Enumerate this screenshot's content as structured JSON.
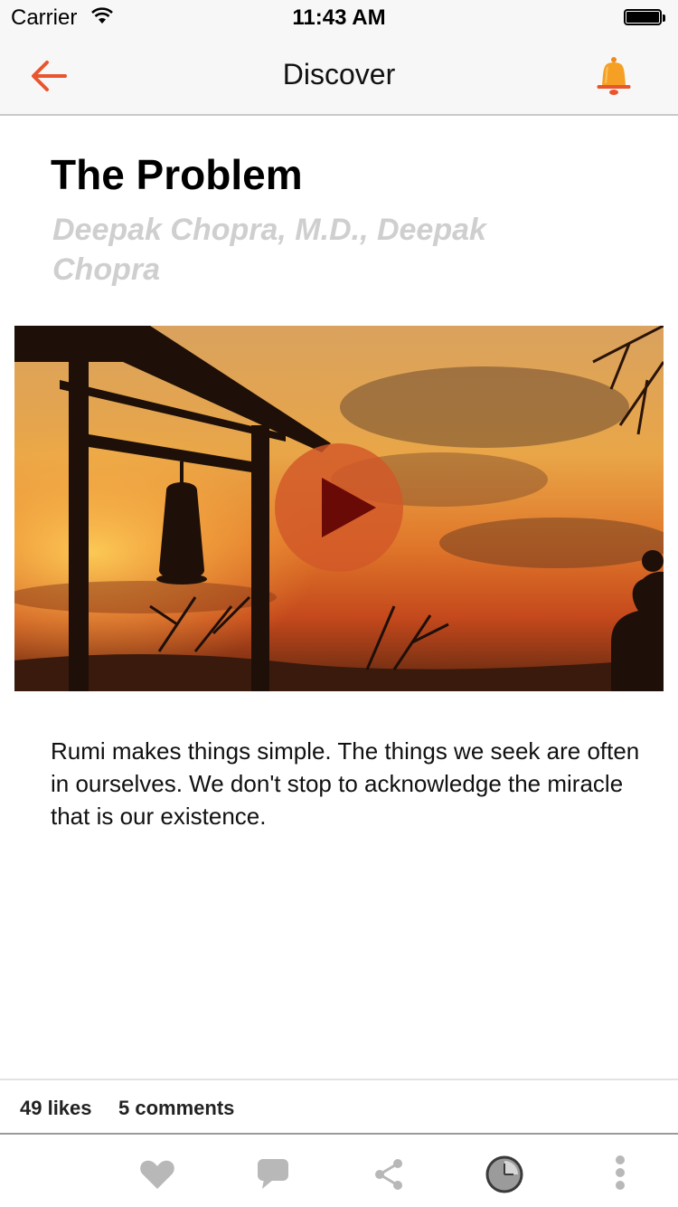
{
  "status_bar": {
    "carrier": "Carrier",
    "time": "11:43 AM"
  },
  "nav": {
    "title": "Discover",
    "back_icon": "arrow-left-icon",
    "bell_icon": "bell-icon"
  },
  "content": {
    "title": "The Problem",
    "author": "Deepak Chopra, M.D., Deepak Chopra",
    "media_icon": "play-icon",
    "description": "Rumi makes things simple. The things we seek are often in ourselves. We don't stop to acknowledge the miracle that is our existence."
  },
  "stats": {
    "likes": "49 likes",
    "comments": "5 comments"
  },
  "toolbar": {
    "icons": [
      "heart-icon",
      "comment-icon",
      "share-icon",
      "clock-icon",
      "more-vertical-icon"
    ]
  },
  "colors": {
    "accent": "#e8552f",
    "bell": "#f08a1c",
    "author_gray": "#cfcfcf",
    "toolbar_gray": "#9b9b9b"
  }
}
